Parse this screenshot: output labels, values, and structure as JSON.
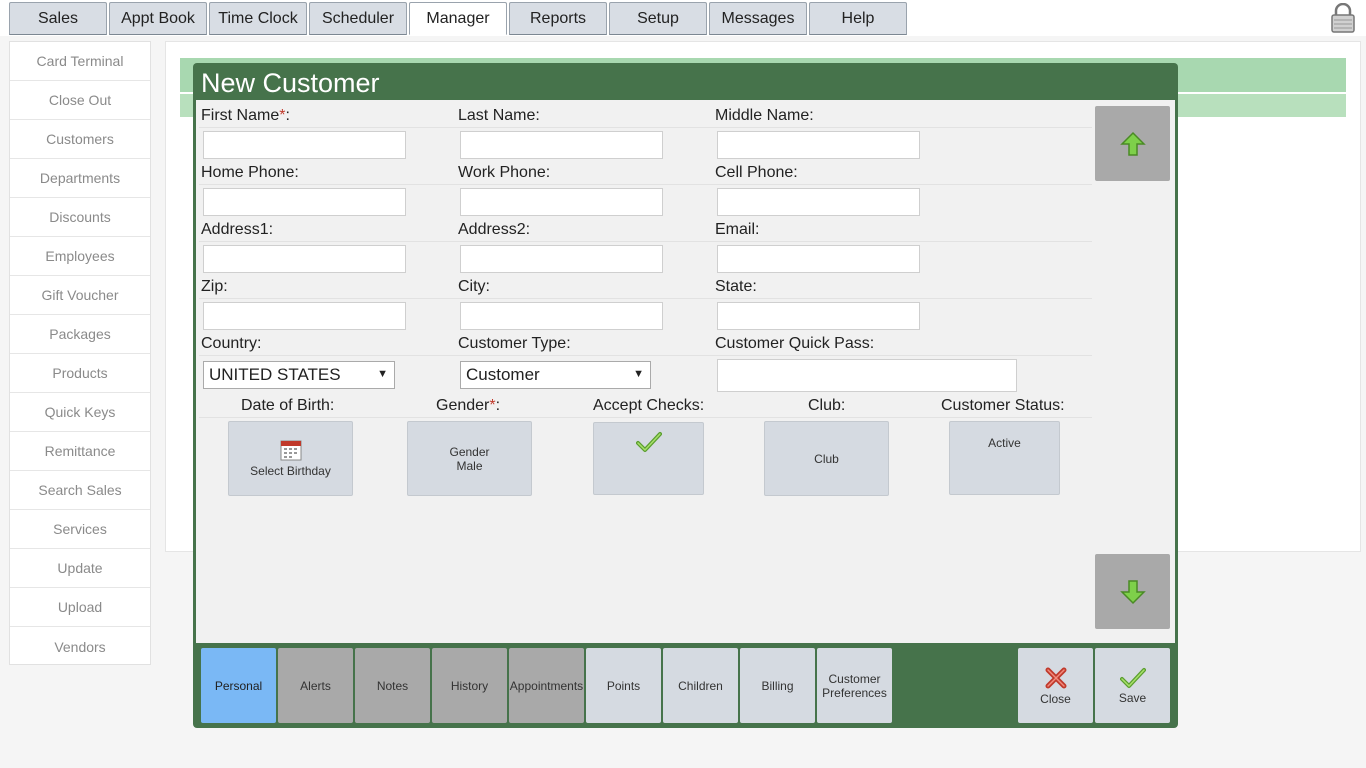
{
  "top_tabs": [
    "Sales",
    "Appt Book",
    "Time Clock",
    "Scheduler",
    "Manager",
    "Reports",
    "Setup",
    "Messages",
    "Help"
  ],
  "active_top_tab": "Manager",
  "sidebar": {
    "items": [
      "Card Terminal",
      "Close Out",
      "Customers",
      "Departments",
      "Discounts",
      "Employees",
      "Gift Voucher",
      "Packages",
      "Products",
      "Quick Keys",
      "Remittance",
      "Search Sales",
      "Services",
      "Update",
      "Upload",
      "Vendors"
    ]
  },
  "modal": {
    "title": "New Customer",
    "fields": {
      "first_name": "First Name",
      "last_name": "Last Name:",
      "middle_name": "Middle Name:",
      "home_phone": "Home Phone:",
      "work_phone": "Work Phone:",
      "cell_phone": "Cell Phone:",
      "address1": "Address1:",
      "address2": "Address2:",
      "email": "Email:",
      "zip": "Zip:",
      "city": "City:",
      "state": "State:",
      "country": "Country:",
      "customer_type": "Customer Type:",
      "quick_pass": "Customer Quick Pass:",
      "dob": "Date of Birth:",
      "gender": "Gender",
      "accept_checks": "Accept Checks:",
      "club": "Club:",
      "status": "Customer Status:"
    },
    "required_marker": "*",
    "colon": ":",
    "values": {
      "country": "UNITED STATES",
      "customer_type": "Customer",
      "select_birthday": "Select Birthday",
      "gender_label": "Gender",
      "gender_value": "Male",
      "club": "Club",
      "status": "Active"
    },
    "bottom_tabs": [
      "Personal",
      "Alerts",
      "Notes",
      "History",
      "Appointments",
      "Points",
      "Children",
      "Billing",
      "Customer Preferences"
    ],
    "active_bottom_tab": "Personal",
    "actions": {
      "close": "Close",
      "save": "Save"
    }
  },
  "colors": {
    "modal_header": "#46734b",
    "active_tab": "#7ab8f5",
    "required": "#c0392b"
  }
}
